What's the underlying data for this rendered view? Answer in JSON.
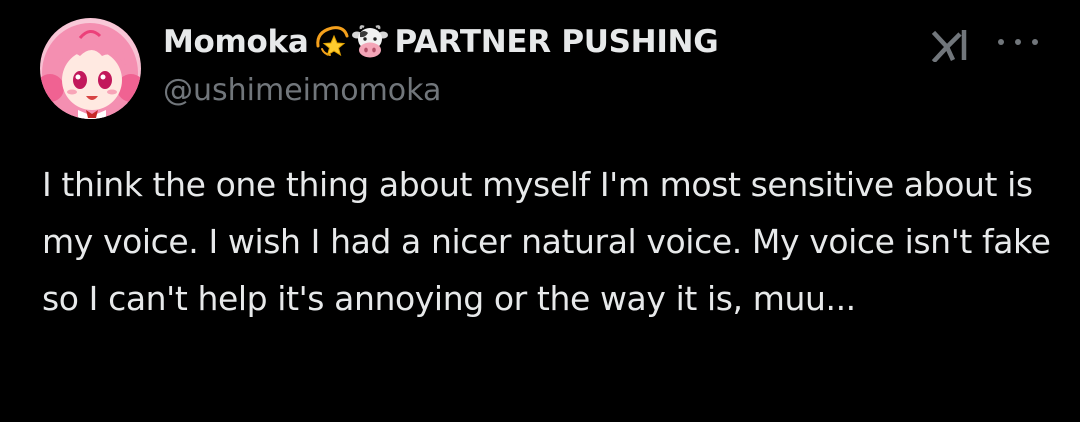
{
  "post": {
    "author": {
      "display_name": "Momoka",
      "name_suffix": "PARTNER PUSHING",
      "handle": "@ushimeimomoka",
      "name_emojis": [
        "dizzy-star-icon",
        "cow-face-icon"
      ]
    },
    "text": "I think the one thing about myself I'm most sensitive about is my voice. I wish I had a nicer natural voice. My voice isn't fake so I can't help it's annoying or the way it is, muu..."
  },
  "colors": {
    "background": "#000000",
    "primary_text": "#e7e9ea",
    "secondary_text": "#71767b"
  },
  "icons": {
    "top_right": [
      "xai-grok-logo-icon",
      "more-options-icon"
    ]
  }
}
